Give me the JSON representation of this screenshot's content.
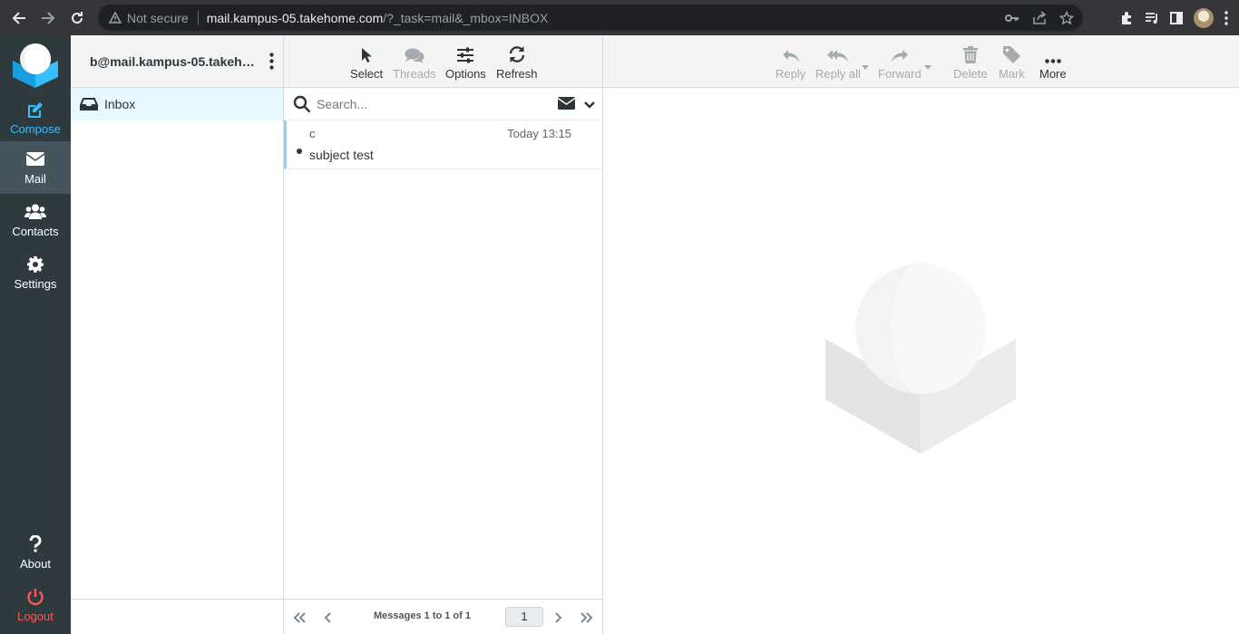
{
  "browser": {
    "security_label": "Not secure",
    "url_host": "mail.kampus-05.takehome.com",
    "url_rest": "/?_task=mail&_mbox=INBOX"
  },
  "nav": {
    "compose": "Compose",
    "mail": "Mail",
    "contacts": "Contacts",
    "settings": "Settings",
    "about": "About",
    "logout": "Logout"
  },
  "folders": {
    "account": "b@mail.kampus-05.takeho...",
    "items": [
      {
        "label": "Inbox"
      }
    ]
  },
  "list_toolbar": {
    "select": "Select",
    "threads": "Threads",
    "options": "Options",
    "refresh": "Refresh"
  },
  "search": {
    "placeholder": "Search..."
  },
  "messages": [
    {
      "from": "c",
      "date": "Today 13:15",
      "subject": "subject test"
    }
  ],
  "pager": {
    "count": "Messages 1 to 1 of 1",
    "page": "1"
  },
  "content_toolbar": {
    "reply": "Reply",
    "reply_all": "Reply all",
    "forward": "Forward",
    "delete": "Delete",
    "mark": "Mark",
    "more": "More"
  },
  "colors": {
    "nav_bg": "#2f3a3f",
    "accent": "#37beff",
    "logout": "#ff5552",
    "selected_folder_bg": "#e6f7fd"
  }
}
